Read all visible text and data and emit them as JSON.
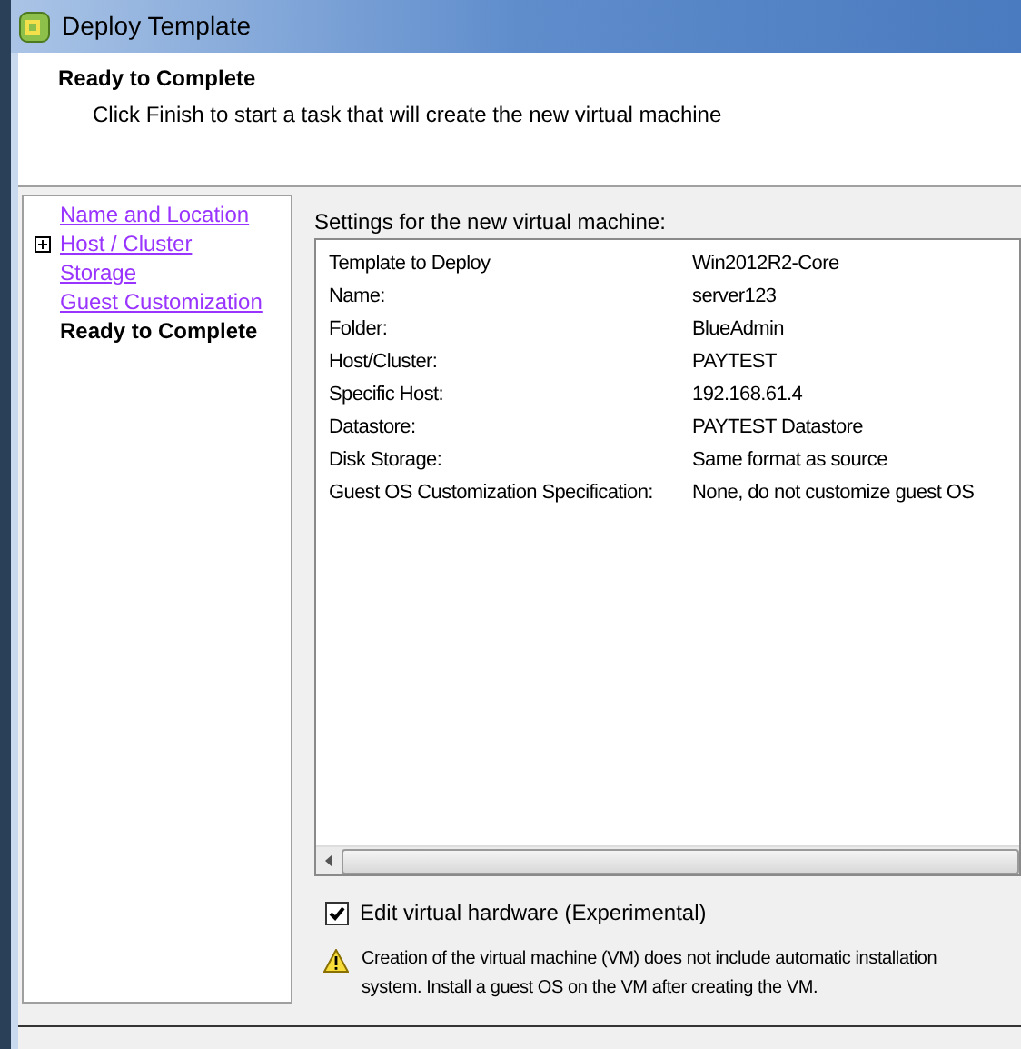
{
  "window": {
    "title": "Deploy Template"
  },
  "header": {
    "title": "Ready to Complete",
    "subtitle": "Click Finish to start a task that will create the new virtual machine"
  },
  "steps": [
    {
      "label": "Name and Location",
      "selected": false,
      "expandable": false
    },
    {
      "label": "Host / Cluster",
      "selected": false,
      "expandable": true
    },
    {
      "label": "Storage",
      "selected": false,
      "expandable": false
    },
    {
      "label": "Guest Customization",
      "selected": false,
      "expandable": false
    },
    {
      "label": "Ready to Complete",
      "selected": true,
      "expandable": false
    }
  ],
  "settings": {
    "label": "Settings for the new virtual machine:",
    "rows": [
      {
        "name": "Template to Deploy",
        "value": "Win2012R2-Core"
      },
      {
        "name": "Name:",
        "value": "server123"
      },
      {
        "name": "Folder:",
        "value": "BlueAdmin"
      },
      {
        "name": "Host/Cluster:",
        "value": "PAYTEST"
      },
      {
        "name": "Specific Host:",
        "value": "192.168.61.4"
      },
      {
        "name": "Datastore:",
        "value": "PAYTEST Datastore"
      },
      {
        "name": "Disk Storage:",
        "value": "Same format as source"
      },
      {
        "name": "Guest OS Customization Specification:",
        "value": "None, do not customize guest OS"
      }
    ]
  },
  "edit_hardware": {
    "label": "Edit virtual hardware (Experimental)",
    "checked": true
  },
  "warning": {
    "line_1": "Creation of the virtual machine (VM) does not include automatic installation",
    "line_2": "system. Install a guest OS on the VM after creating the VM."
  }
}
